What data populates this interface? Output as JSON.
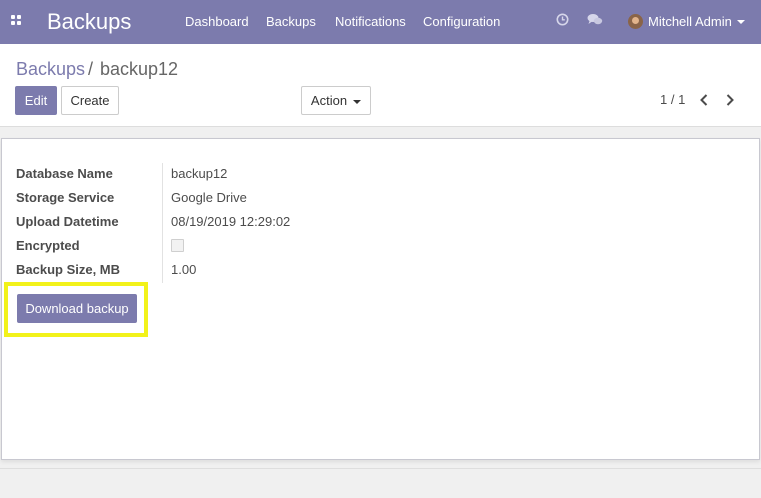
{
  "navbar": {
    "app_title": "Backups",
    "menu": [
      "Dashboard",
      "Backups",
      "Notifications",
      "Configuration"
    ],
    "icons": {
      "apps": "apps-grid-icon",
      "activity": "clock-icon",
      "discuss": "chat-bubbles-icon"
    },
    "user_name": "Mitchell Admin"
  },
  "breadcrumb": {
    "root": "Backups",
    "separator": "/",
    "current": "backup12"
  },
  "buttons": {
    "edit": "Edit",
    "create": "Create",
    "action": "Action"
  },
  "pager": {
    "value": "1 / 1"
  },
  "form": {
    "fields": [
      {
        "label": "Database Name",
        "value": "backup12"
      },
      {
        "label": "Storage Service",
        "value": "Google Drive"
      },
      {
        "label": "Upload Datetime",
        "value": "08/19/2019 12:29:02"
      },
      {
        "label": "Encrypted",
        "value": false
      },
      {
        "label": "Backup Size, MB",
        "value": "1.00"
      }
    ],
    "download_button": "Download backup"
  },
  "colors": {
    "brand": "#7c7bad",
    "highlight": "#f2f21a"
  }
}
